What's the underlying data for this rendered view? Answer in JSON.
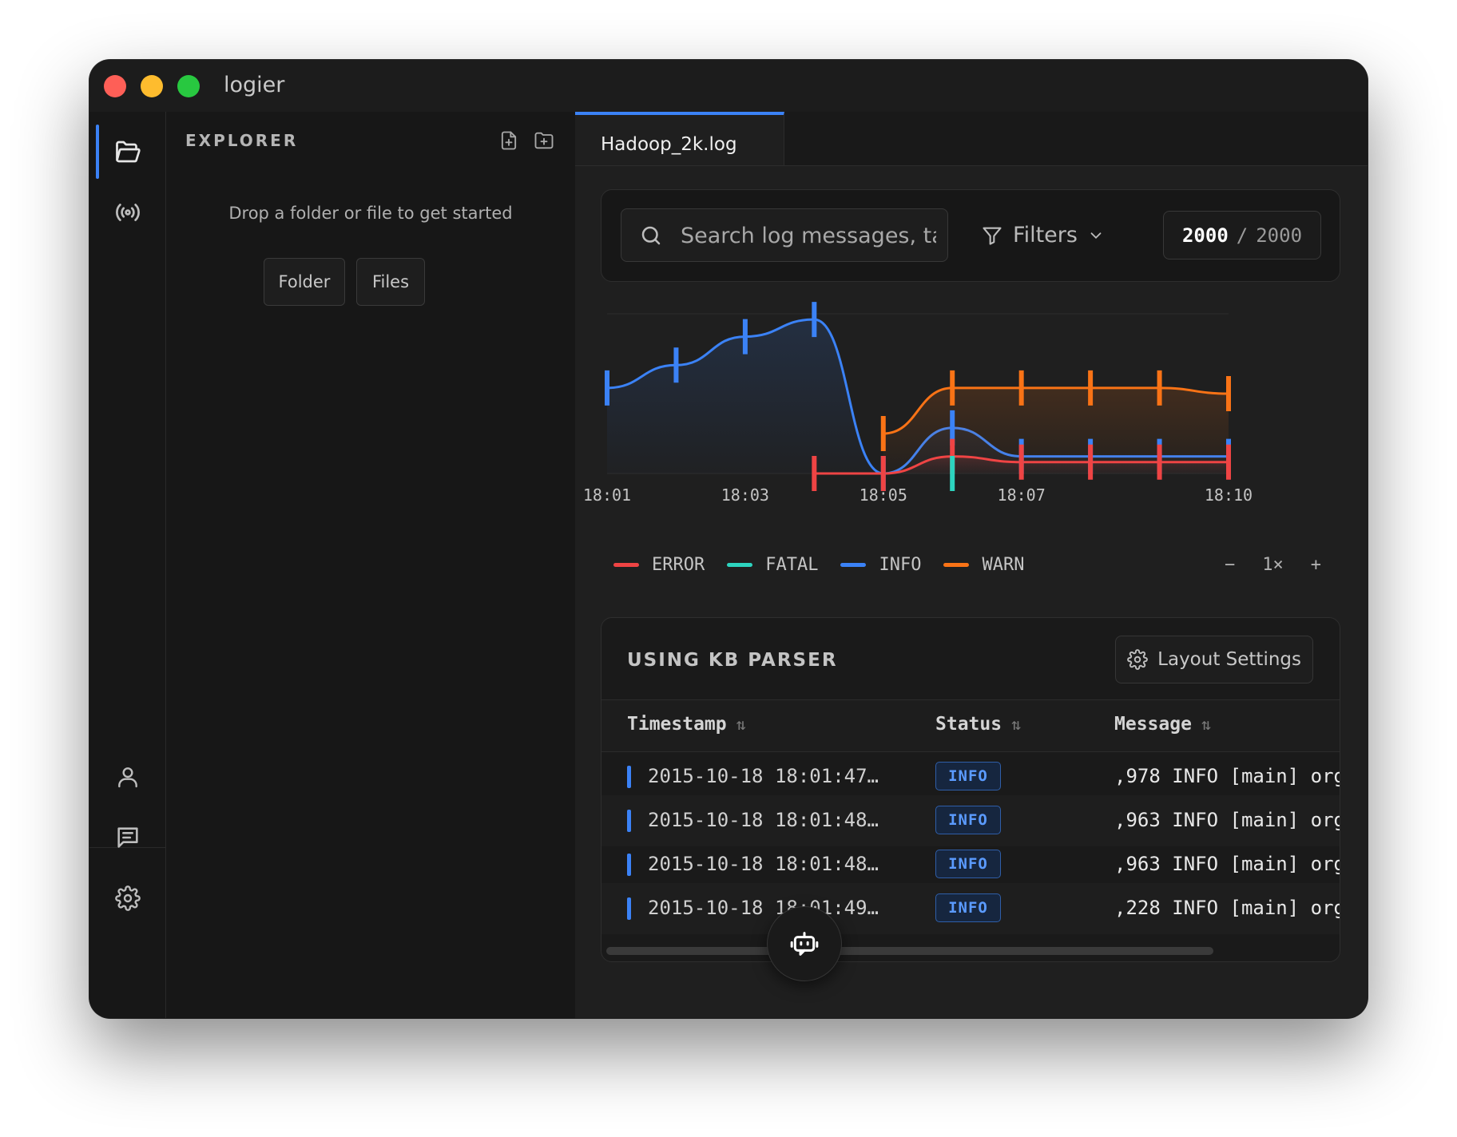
{
  "app": {
    "title": "logier"
  },
  "activity_bar": {
    "top_items": [
      {
        "icon": "folder-open-icon",
        "active": true
      },
      {
        "icon": "broadcast-icon",
        "active": false
      }
    ],
    "bottom_items": [
      {
        "icon": "user-icon"
      },
      {
        "icon": "message-icon"
      },
      {
        "icon": "gear-icon"
      }
    ]
  },
  "explorer": {
    "title": "EXPLORER",
    "actions": [
      "new-file-icon",
      "new-folder-icon"
    ],
    "empty_text": "Drop a folder or file to get started",
    "folder_button": "Folder",
    "files_button": "Files"
  },
  "tabs": [
    {
      "label": "Hadoop_2k.log",
      "active": true
    }
  ],
  "search": {
    "placeholder": "Search log messages, tags...",
    "filters_label": "Filters",
    "count_shown": "2000",
    "count_separator": "/",
    "count_total": "2000"
  },
  "chart_data": {
    "type": "line",
    "x": [
      "18:01",
      "18:02",
      "18:03",
      "18:04",
      "18:05",
      "18:06",
      "18:07",
      "18:08",
      "18:09",
      "18:10"
    ],
    "x_tick_labels": [
      "18:01",
      "18:03",
      "18:05",
      "18:07",
      "18:10"
    ],
    "series": [
      {
        "name": "ERROR",
        "color": "#ef4444",
        "values": [
          null,
          null,
          null,
          0,
          0,
          3,
          2,
          2,
          2,
          2
        ]
      },
      {
        "name": "FATAL",
        "color": "#2dd4bf",
        "values": [
          null,
          null,
          null,
          null,
          null,
          0,
          null,
          null,
          null,
          null
        ]
      },
      {
        "name": "INFO",
        "color": "#3b82f6",
        "values": [
          15,
          19,
          24,
          27,
          0,
          8,
          3,
          3,
          3,
          3
        ]
      },
      {
        "name": "WARN",
        "color": "#f97316",
        "values": [
          null,
          null,
          null,
          null,
          7,
          15,
          15,
          15,
          15,
          14
        ]
      }
    ],
    "ylim": [
      0,
      28
    ],
    "grid": true,
    "legend": "bottom-left"
  },
  "legend": [
    {
      "name": "ERROR",
      "color": "#ef4444"
    },
    {
      "name": "FATAL",
      "color": "#2dd4bf"
    },
    {
      "name": "INFO",
      "color": "#3b82f6"
    },
    {
      "name": "WARN",
      "color": "#f97316"
    }
  ],
  "zoom": {
    "minus": "−",
    "level": "1×",
    "plus": "+"
  },
  "parser": {
    "title": "USING KB PARSER",
    "layout_button": "Layout Settings"
  },
  "table": {
    "columns": [
      "Timestamp",
      "Status",
      "Message"
    ],
    "rows": [
      {
        "timestamp": "2015-10-18 18:01:47…",
        "status": "INFO",
        "message": ",978 INFO [main] org"
      },
      {
        "timestamp": "2015-10-18 18:01:48…",
        "status": "INFO",
        "message": ",963 INFO [main] org"
      },
      {
        "timestamp": "2015-10-18 18:01:48…",
        "status": "INFO",
        "message": ",963 INFO [main] org"
      },
      {
        "timestamp": "2015-10-18 18:01:49…",
        "status": "INFO",
        "message": ",228 INFO [main] org"
      }
    ]
  },
  "assistant": {
    "icon": "bot-icon"
  }
}
